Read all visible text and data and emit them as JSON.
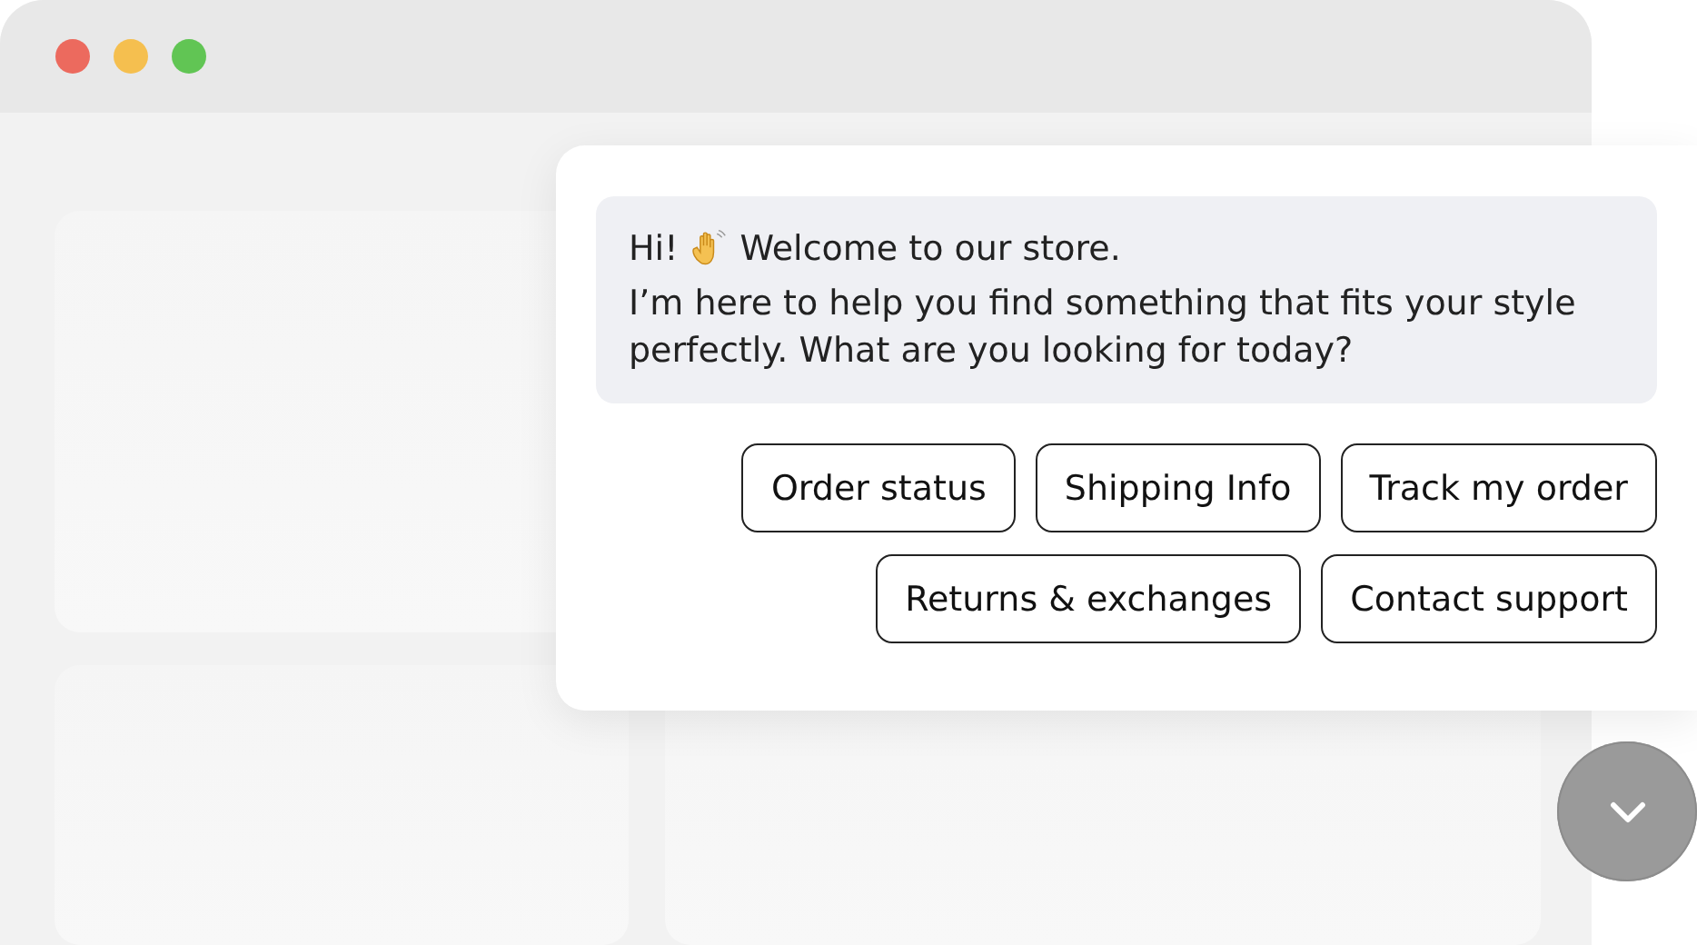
{
  "chat": {
    "message": {
      "greeting": "Hi!",
      "welcome": "Welcome to our store.",
      "body": "I’m here to help you find something that fits your style perfectly. What are you looking for today?"
    },
    "quick_replies": [
      {
        "label": "Order status"
      },
      {
        "label": "Shipping Info"
      },
      {
        "label": "Track my order"
      },
      {
        "label": "Returns & exchanges"
      },
      {
        "label": "Contact support"
      }
    ]
  }
}
